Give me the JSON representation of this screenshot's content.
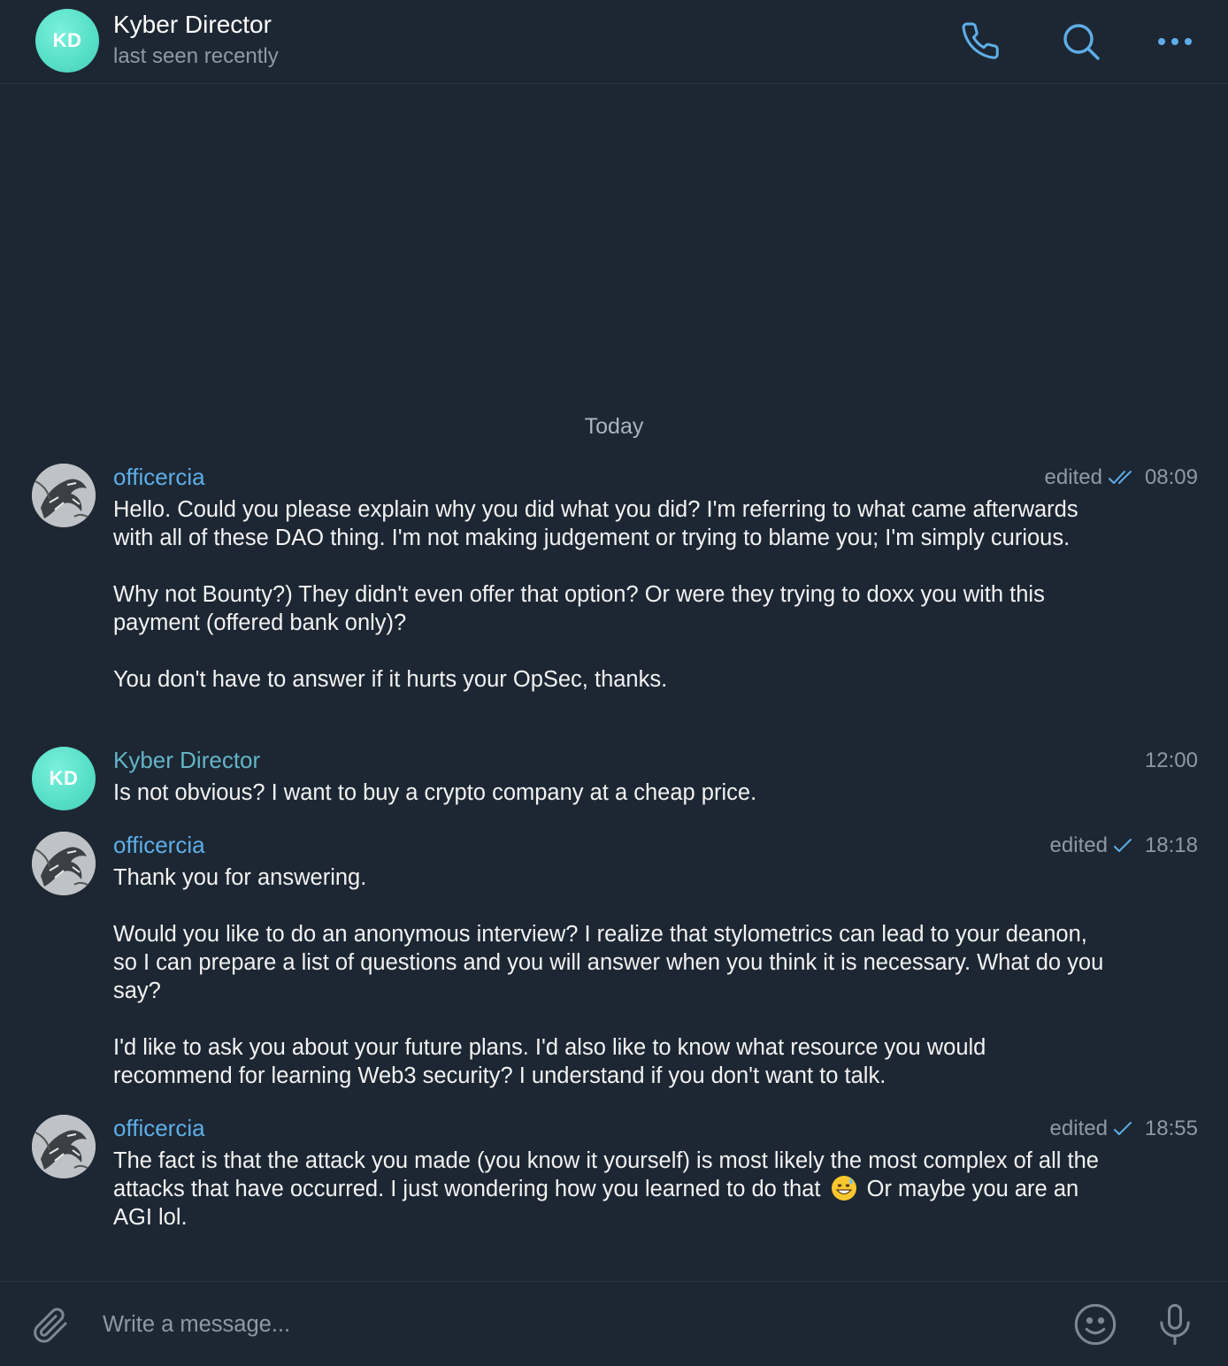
{
  "header": {
    "avatar_initials": "KD",
    "title": "Kyber Director",
    "status": "last seen recently",
    "icons": [
      "phone-icon",
      "search-icon",
      "more-icon"
    ]
  },
  "chat": {
    "date_separator": "Today",
    "messages": [
      {
        "sender": "officercia",
        "edited_label": "edited",
        "read_state": "double-check",
        "time": "08:09",
        "paragraphs": [
          "Hello. Could you please explain why you did what you did? I'm referring to what came afterwards with all of these DAO thing. I'm not making judgement or trying to blame you; I'm simply curious.",
          "Why not Bounty?) They didn't even offer that option? Or were they trying to doxx you with this payment (offered bank only)?",
          "You don't have to answer if it hurts your OpSec, thanks."
        ]
      },
      {
        "sender": "Kyber Director",
        "avatar_initials": "KD",
        "time": "12:00",
        "paragraphs": [
          "Is not obvious? I want to buy a crypto company at a cheap price."
        ]
      },
      {
        "sender": "officercia",
        "edited_label": "edited",
        "read_state": "single-check",
        "time": "18:18",
        "paragraphs": [
          "Thank you for answering.",
          "Would you like to do an anonymous interview? I realize that stylometrics can lead to your deanon, so I can prepare a list of questions and you will answer when you think it is necessary. What do you say?",
          "I'd like to ask you about your future plans. I'd also like to know what resource you would recommend for learning Web3 security? I understand if you don't want to talk."
        ]
      },
      {
        "sender": "officercia",
        "edited_label": "edited",
        "read_state": "single-check",
        "time": "18:55",
        "text_before_emoji": "The fact is that the attack you made (you know it yourself) is most likely the most complex of all the attacks that have occurred. I just wondering how you learned to do that",
        "emoji": "grinning-sweat-emoji",
        "text_after_emoji": "Or maybe you are an AGI lol."
      }
    ]
  },
  "composer": {
    "placeholder": "Write a message...",
    "icons": [
      "attach-icon",
      "emoji-icon",
      "microphone-icon"
    ]
  },
  "colors": {
    "background": "#1d2733",
    "accent": "#5eaee8",
    "avatar_kd": "#58e0c8",
    "muted": "#8e99a6"
  }
}
